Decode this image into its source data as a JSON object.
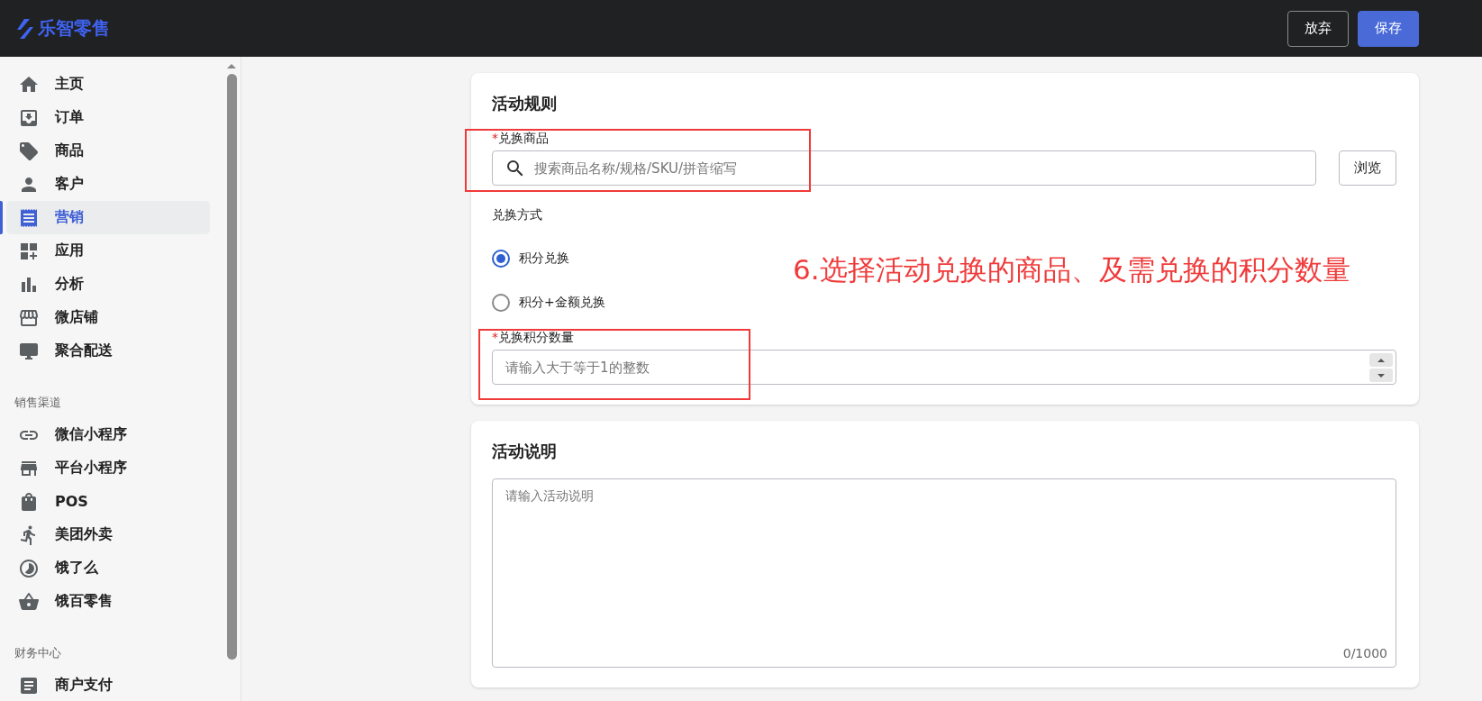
{
  "header": {
    "logo": "乐智零售",
    "buttons": [
      {
        "label": "放弃",
        "kind": "secondary"
      },
      {
        "label": "保存",
        "kind": "primary"
      }
    ]
  },
  "sidebar": {
    "groups": [
      {
        "items": [
          {
            "label": "主页",
            "selected": false
          },
          {
            "label": "订单",
            "selected": false
          },
          {
            "label": "商品",
            "selected": false
          },
          {
            "label": "客户",
            "selected": false
          },
          {
            "label": "营销",
            "selected": true
          },
          {
            "label": "应用",
            "selected": false
          },
          {
            "label": "分析",
            "selected": false
          },
          {
            "label": "微店铺",
            "selected": false
          },
          {
            "label": "聚合配送",
            "selected": false
          }
        ]
      },
      {
        "title": "销售渠道",
        "items": [
          {
            "label": "微信小程序",
            "selected": false
          },
          {
            "label": "平台小程序",
            "selected": false
          },
          {
            "label": "POS",
            "selected": false
          },
          {
            "label": "美团外卖",
            "selected": false
          },
          {
            "label": "饿了么",
            "selected": false
          },
          {
            "label": "饿百零售",
            "selected": false
          }
        ]
      },
      {
        "title": "财务中心",
        "items": [
          {
            "label": "商户支付",
            "selected": false
          }
        ]
      }
    ]
  },
  "rules": {
    "title": "活动规则",
    "product": {
      "required_mark": "*",
      "label": "兑换商品",
      "placeholder": "搜索商品名称/规格/SKU/拼音缩写",
      "button": "浏览"
    },
    "method": {
      "label": "兑换方式",
      "options": [
        {
          "label": "积分兑换",
          "selected": true
        },
        {
          "label": "积分+金额兑换",
          "selected": false
        }
      ]
    },
    "points": {
      "required_mark": "*",
      "label": "兑换积分数量",
      "placeholder": "请输入大于等于1的整数"
    }
  },
  "annotation": "6.选择活动兑换的商品、及需兑换的积分数量",
  "description": {
    "title": "活动说明",
    "placeholder": "请输入活动说明",
    "counter": "0/1000"
  }
}
